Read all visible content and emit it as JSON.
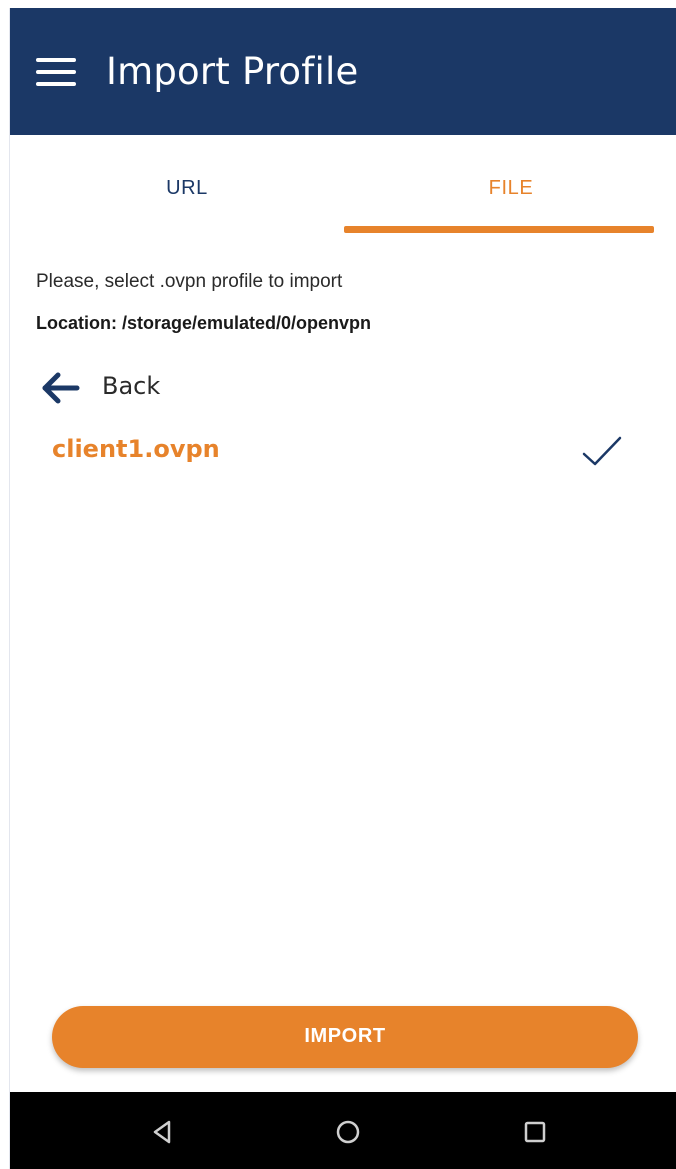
{
  "app_bar": {
    "title": "Import Profile",
    "menu_icon": "hamburger-menu-icon"
  },
  "tabs": [
    {
      "label": "URL",
      "selected": false
    },
    {
      "label": "FILE",
      "selected": true
    }
  ],
  "content": {
    "instruction": "Please, select .ovpn profile to import",
    "location": "Location: /storage/emulated/0/openvpn",
    "back": {
      "label": "Back",
      "icon": "arrow-left-icon"
    },
    "files": [
      {
        "name": "client1.ovpn",
        "selected": true,
        "icon": "checkmark-icon"
      }
    ]
  },
  "import_button": {
    "label": "IMPORT"
  },
  "system_nav": {
    "icons": [
      "nav-back-triangle-icon",
      "nav-home-circle-icon",
      "nav-recents-square-icon"
    ]
  },
  "colors": {
    "primary": "#1b3866",
    "accent": "#e7832b",
    "background": "#ffffff",
    "nav_bar": "#000000"
  }
}
